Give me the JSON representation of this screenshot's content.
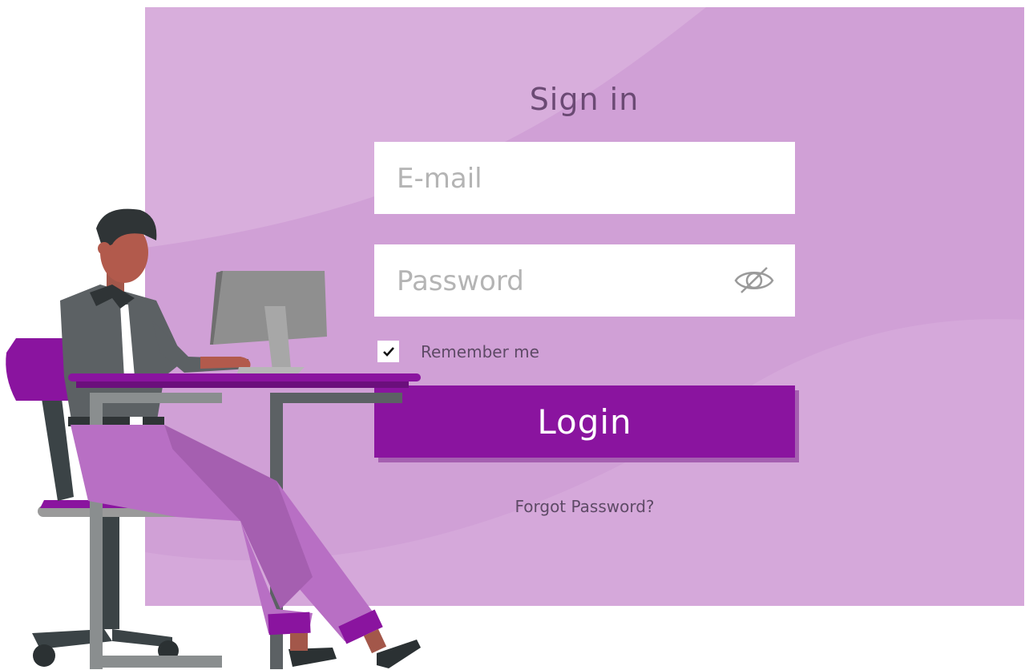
{
  "form": {
    "title": "Sign in",
    "email_placeholder": "E-mail",
    "password_placeholder": "Password",
    "remember_label": "Remember me",
    "remember_checked": true,
    "login_label": "Login",
    "forgot_label": "Forgot Password?"
  },
  "colors": {
    "panel_background": "#d0a0d6",
    "panel_wave_light": "#d8aedc",
    "primary_button": "#8a149f",
    "title_text": "#6b4a74"
  },
  "icons": {
    "password_toggle": "eye-slash-icon",
    "checkbox_mark": "checkmark-icon"
  },
  "illustration": {
    "subject": "man-working-at-desk-illustration"
  }
}
